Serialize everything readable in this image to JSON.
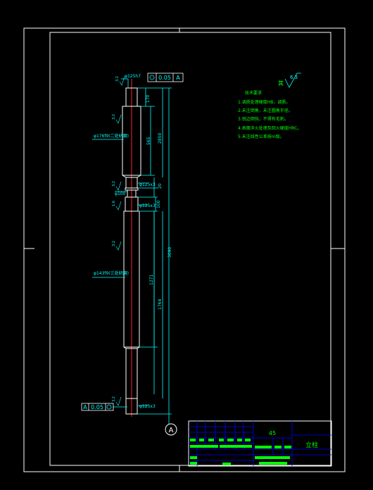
{
  "drawing": {
    "material": "45",
    "part_name": "立柱",
    "datum_label": "A",
    "roughness_symbol": "6.3",
    "roughness_prefix": "其",
    "tech_requirements": {
      "title": "技术要求",
      "items": [
        "1.调质处理硬度HB，调质。",
        "2.未注倒角，未注圆角半径。",
        "3.锐边倒钝，不得有毛刺。",
        "4.表面淬火处理及回火硬度HRC。",
        "5.未注线性公差按m级。"
      ]
    },
    "tolerance_frames": [
      {
        "symbol": "◎",
        "value": "0.05",
        "datum": "A"
      },
      {
        "symbol": "◎",
        "value": "0.05",
        "datum": "A"
      }
    ],
    "dimensions": {
      "top_dia": "φ125h7",
      "upper_body_dia": "φ176f9(二处研磨)",
      "groove_dia": "φ100",
      "mid_dia1": "φ125x3",
      "mid_dia2": "φ125x3",
      "lower_body_dia": "φ143f9(三处研磨)",
      "bottom_dia": "φ125x3",
      "len_top": "170",
      "len_upper": "565",
      "len_upper_total": "2850",
      "len_groove": "20",
      "len_mid": "100",
      "len_lower": "1271",
      "len_lower_total": "1764",
      "overall": "3090",
      "roughness_values": [
        "3.2",
        "3.2",
        "3.2",
        "1.6",
        "3.2",
        "3.2"
      ]
    }
  },
  "colors": {
    "frame": "#ffffff",
    "part": "#ffffff",
    "centerline": "#ff2020",
    "dimension": "#00ffff",
    "text": "#00ff00",
    "title_block": "#0000ff"
  }
}
